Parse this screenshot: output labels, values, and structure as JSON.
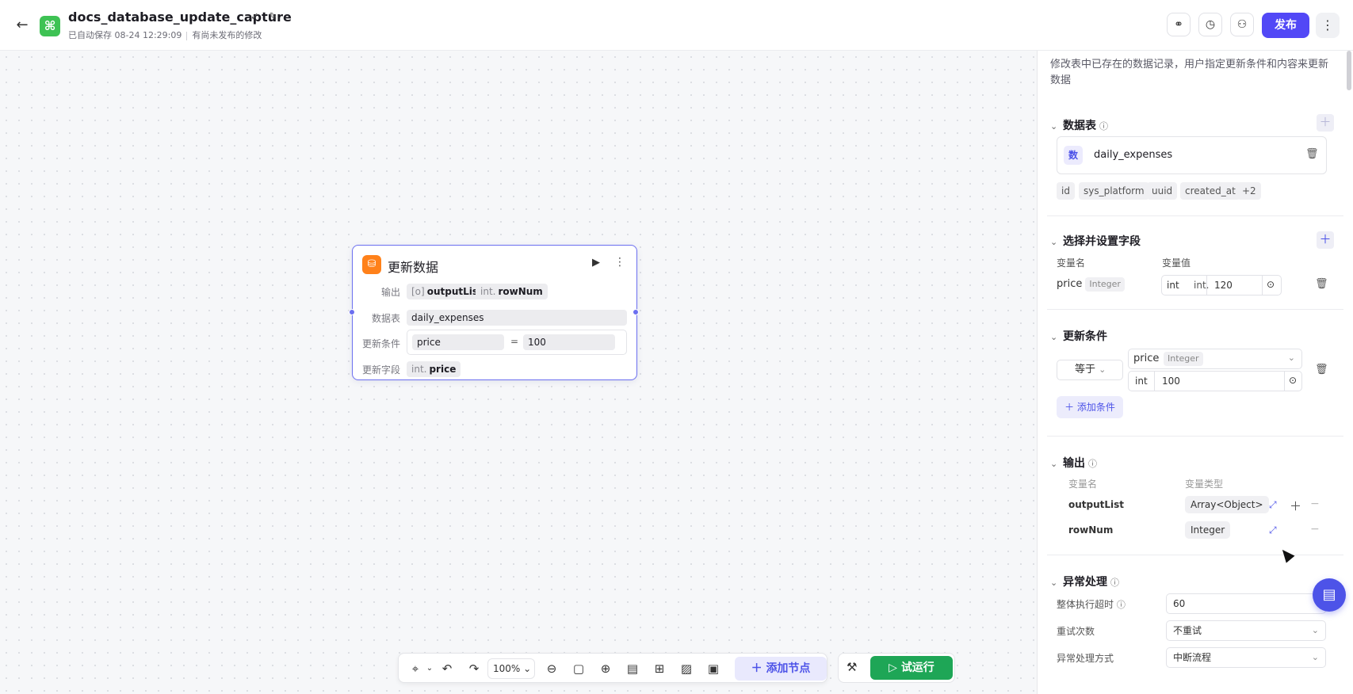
{
  "header": {
    "title": "docs_database_update_capture",
    "autosave": "已自动保存 08-24 12:29:09",
    "unpublished": "有尚未发布的修改",
    "publish_label": "发布"
  },
  "node": {
    "title": "更新数据",
    "output_label": "输出",
    "output_tags": [
      {
        "prefix": "[o]",
        "name": "outputList"
      },
      {
        "prefix": "int.",
        "name": "rowNum"
      }
    ],
    "table_label": "数据表",
    "table_value": "daily_expenses",
    "condition_label": "更新条件",
    "condition_left": "price",
    "condition_op": "=",
    "condition_right": "100",
    "fields_label": "更新字段",
    "fields_tag_prefix": "int.",
    "fields_tag_name": "price"
  },
  "toolbar": {
    "zoom": "100%",
    "add_node": "添加节点",
    "run": "试运行"
  },
  "panel": {
    "description": "修改表中已存在的数据记录，用户指定更新条件和内容来更新数据",
    "table_section": {
      "title": "数据表",
      "db_icon": "数",
      "db_name": "daily_expenses",
      "columns": [
        "id",
        "sys_platform",
        "uuid",
        "created_at",
        "+2"
      ]
    },
    "fields_section": {
      "title": "选择并设置字段",
      "col_name": "变量名",
      "col_value": "变量值",
      "field_name": "price",
      "field_type": "Integer",
      "value_type1": "int",
      "value_type2": "int.",
      "value": "120"
    },
    "condition_section": {
      "title": "更新条件",
      "operator": "等于",
      "field_name": "price",
      "field_type": "Integer",
      "value_type": "int",
      "value": "100",
      "add_label": "添加条件"
    },
    "output_section": {
      "title": "输出",
      "col_name": "变量名",
      "col_type": "变量类型",
      "rows": [
        {
          "name": "outputList",
          "type": "Array<Object>"
        },
        {
          "name": "rowNum",
          "type": "Integer"
        }
      ]
    },
    "error_section": {
      "title": "异常处理",
      "timeout_label": "整体执行超时",
      "timeout_value": "60",
      "retry_label": "重试次数",
      "retry_value": "不重试",
      "handling_label": "异常处理方式",
      "handling_value": "中断流程"
    }
  }
}
